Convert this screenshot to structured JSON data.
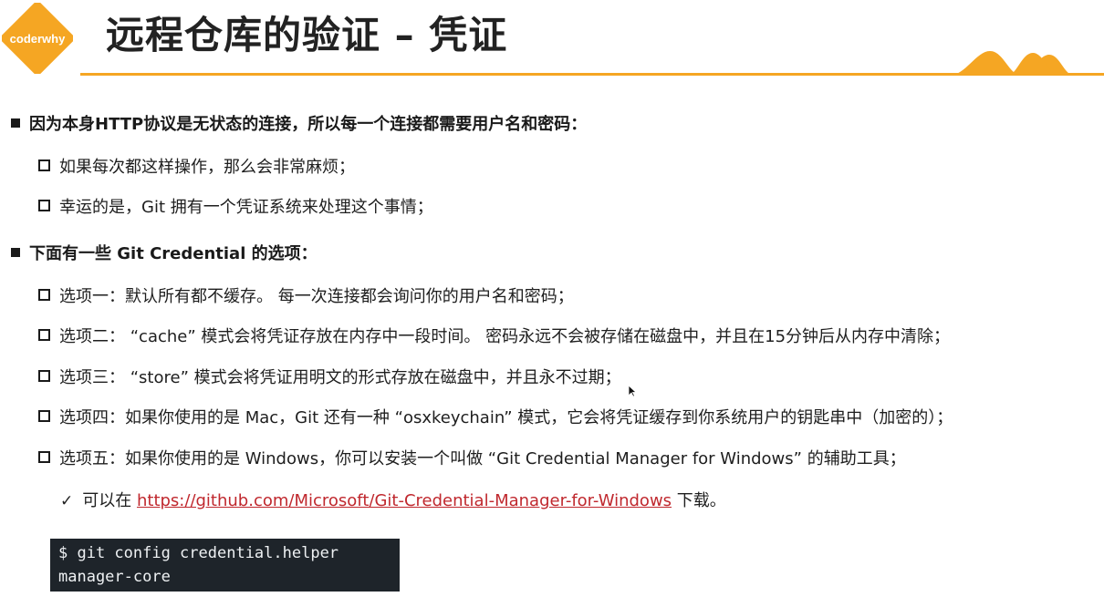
{
  "logo": {
    "text": "coderwhy",
    "color": "#f5a623"
  },
  "title": "远程仓库的验证 – 凭证",
  "accent_color": "#f5a623",
  "items": [
    {
      "level": 1,
      "text": "因为本身HTTP协议是无状态的连接，所以每一个连接都需要用户名和密码："
    },
    {
      "level": 2,
      "text": "如果每次都这样操作，那么会非常麻烦；"
    },
    {
      "level": 2,
      "text": "幸运的是，Git 拥有一个凭证系统来处理这个事情；"
    },
    {
      "level": 1,
      "text": "下面有一些 Git Credential 的选项："
    },
    {
      "level": 2,
      "text": "选项一：默认所有都不缓存。 每一次连接都会询问你的用户名和密码；"
    },
    {
      "level": 2,
      "text": "选项二： “cache” 模式会将凭证存放在内存中一段时间。 密码永远不会被存储在磁盘中，并且在15分钟后从内存中清除；"
    },
    {
      "level": 2,
      "text": "选项三： “store” 模式会将凭证用明文的形式存放在磁盘中，并且永不过期；"
    },
    {
      "level": 2,
      "text": "选项四：如果你使用的是 Mac，Git 还有一种 “osxkeychain” 模式，它会将凭证缓存到你系统用户的钥匙串中（加密的）；"
    },
    {
      "level": 2,
      "text": "选项五：如果你使用的是 Windows，你可以安装一个叫做 “Git Credential Manager for Windows” 的辅助工具；"
    }
  ],
  "download": {
    "check_icon": "✓",
    "prefix": "可以在",
    "link_text": "https://github.com/Microsoft/Git-Credential-Manager-for-Windows",
    "link_color": "#c0282e",
    "suffix": "下载。"
  },
  "code": {
    "line1": "$ git config credential.helper",
    "line2": "manager-core"
  }
}
